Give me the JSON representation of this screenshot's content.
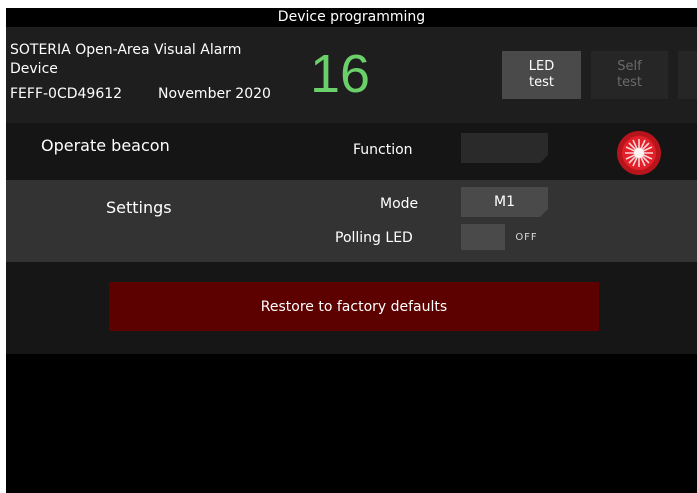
{
  "window": {
    "title": "Device programming"
  },
  "device": {
    "name": "SOTERIA Open-Area Visual Alarm Device",
    "id": "FEFF-0CD49612",
    "date": "November 2020",
    "address": "16"
  },
  "buttons": {
    "led_test": [
      "LED",
      "test"
    ],
    "self_test": [
      "Self",
      "test"
    ]
  },
  "operate": {
    "label": "Operate beacon",
    "function_label": "Function",
    "beacon_icon": "red-flashing-beacon-icon"
  },
  "settings": {
    "label": "Settings",
    "mode_label": "Mode",
    "mode_value": "M1",
    "polling_label": "Polling LED",
    "polling_state": "OFF"
  },
  "restore": {
    "label": "Restore to factory defaults"
  },
  "colors": {
    "address": "#6cd06a",
    "restore_bg": "#5c0000",
    "beacon": "#e2202a"
  }
}
